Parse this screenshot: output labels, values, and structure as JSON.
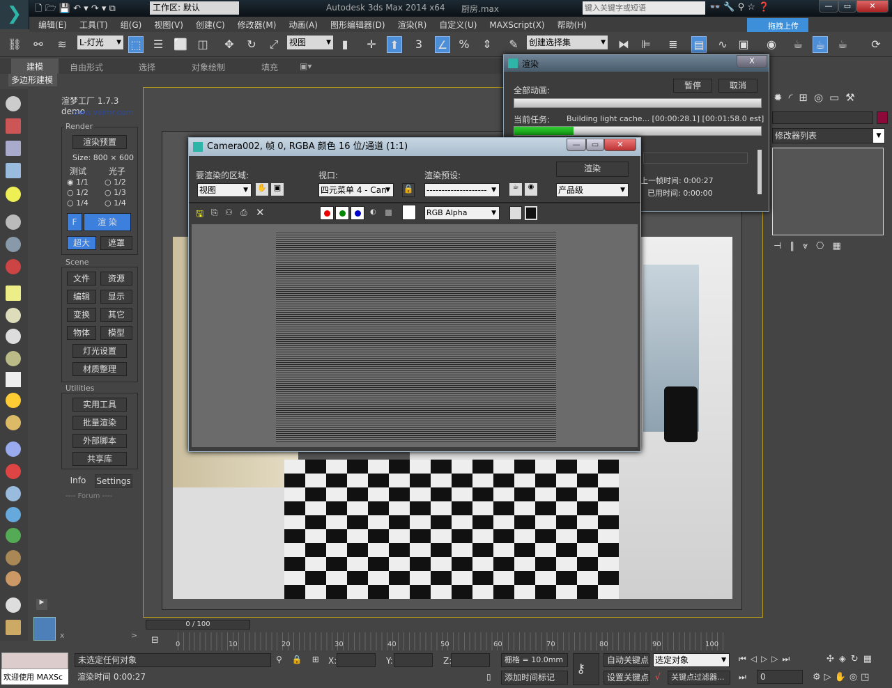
{
  "titlebar": {
    "workspace": "工作区: 默认",
    "title": "Autodesk 3ds Max  2014 x64",
    "file": "厨房.max",
    "search_placeholder": "键入关键字或短语",
    "min": "—",
    "max": "▭",
    "close": "✕",
    "upload": "拖拽上传"
  },
  "menu": [
    "编辑(E)",
    "工具(T)",
    "组(G)",
    "视图(V)",
    "创建(C)",
    "修改器(M)",
    "动画(A)",
    "图形编辑器(D)",
    "渲染(R)",
    "自定义(U)",
    "MAXScript(X)",
    "帮助(H)"
  ],
  "toolbar": {
    "layer": "L-灯光",
    "refcoord": "视图",
    "selset": "创建选择集",
    "snap3": "3",
    "pct": "%"
  },
  "ribbon": {
    "tabs": [
      "建模",
      "自由形式",
      "选择",
      "对象绘制",
      "填充"
    ],
    "sub": "多边形建模"
  },
  "plugin": {
    "title": "渲梦工厂 1.7.3 demo",
    "url": "www.veimr.com",
    "render_group": "Render",
    "preset": "渲染预置",
    "size": "Size: 800 × 600",
    "test": "测试",
    "photon": "光子",
    "test_opts": [
      "1/1",
      "1/2",
      "1/4"
    ],
    "photon_opts": [
      "1/2",
      "1/3",
      "1/4"
    ],
    "f": "F",
    "render": "渲 染",
    "big": "超大",
    "mask": "遮罩",
    "scene_group": "Scene",
    "scene_btns": [
      "文件",
      "资源",
      "编辑",
      "显示",
      "变换",
      "其它",
      "物体",
      "模型"
    ],
    "light": "灯光设置",
    "material": "材质整理",
    "util_group": "Utilities",
    "util_btns": [
      "实用工具",
      "批量渲染",
      "外部脚本",
      "共享库"
    ],
    "info": "Info",
    "settings": "Settings",
    "forum": "---- Forum ----",
    "x": "x",
    ">": ">"
  },
  "vfb": {
    "title": "Camera002, 帧 0, RGBA 颜色 16 位/通道 (1:1)",
    "area_label": "要渲染的区域:",
    "area": "视图",
    "viewport_label": "视口:",
    "viewport": "四元菜单 4 - Can",
    "preset_label": "渲染预设:",
    "preset": "--------------------",
    "render": "渲染",
    "quality": "产品级",
    "channel": "RGB Alpha"
  },
  "render_dialog": {
    "title": "渲染",
    "all_anim": "全部动画:",
    "pause": "暂停",
    "cancel": "取消",
    "current_task": "当前任务:",
    "task_text": "Building light cache... [00:00:28.1] [00:01:58.0 est]",
    "task_progress": 0.24,
    "all_progress": 0,
    "last_frame": "上一帧时间:  0:00:27",
    "elapsed": "已用时间:  0:00:00",
    "close": "X"
  },
  "cmd": {
    "modifier_list": "修改器列表",
    "color": "#8b0a3a"
  },
  "timeline": {
    "frame": "0 / 100",
    "ticks": [
      "0",
      "10",
      "20",
      "30",
      "40",
      "50",
      "60",
      "70",
      "80",
      "90",
      "100"
    ]
  },
  "status": {
    "welcome": "欢迎使用 MAXSc",
    "no_select": "未选定任何对象",
    "render_time": "渲染时间 0:00:27",
    "x": "X:",
    "y": "Y:",
    "z": "Z:",
    "grid": "栅格 = 10.0mm",
    "add_tag": "添加时间标记",
    "auto_key": "自动关键点",
    "set_key": "设置关键点",
    "sel": "选定对象",
    "key_filter": "关键点过滤器...",
    "frame": "0"
  }
}
